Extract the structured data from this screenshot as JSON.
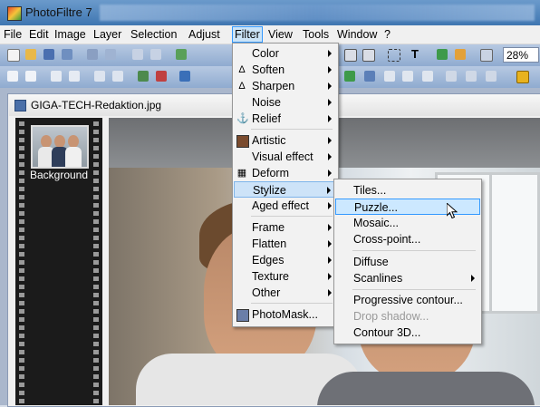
{
  "app": {
    "title": "PhotoFiltre 7"
  },
  "menubar": [
    "File",
    "Edit",
    "Image",
    "Layer",
    "Selection",
    "Adjust",
    "Filter",
    "View",
    "Tools",
    "Window",
    "?"
  ],
  "toolbar": {
    "zoom": "28%"
  },
  "document": {
    "title": "GIGA-TECH-Redaktion.jpg"
  },
  "layers": {
    "background_label": "Background"
  },
  "filter_menu": {
    "items": [
      {
        "label": "Color",
        "submenu": true
      },
      {
        "label": "Soften",
        "submenu": true,
        "icon": "drop-icon"
      },
      {
        "label": "Sharpen",
        "submenu": true,
        "icon": "drop-icon"
      },
      {
        "label": "Noise",
        "submenu": true
      },
      {
        "label": "Relief",
        "submenu": true,
        "icon": "relief-icon"
      },
      {
        "label": "Artistic",
        "submenu": true,
        "icon": "artistic-icon"
      },
      {
        "label": "Visual effect",
        "submenu": true
      },
      {
        "label": "Deform",
        "submenu": true,
        "icon": "grid-icon"
      },
      {
        "label": "Stylize",
        "submenu": true,
        "selected": true
      },
      {
        "label": "Aged effect",
        "submenu": true
      },
      {
        "label": "Frame",
        "submenu": true
      },
      {
        "label": "Flatten",
        "submenu": true
      },
      {
        "label": "Edges",
        "submenu": true
      },
      {
        "label": "Texture",
        "submenu": true
      },
      {
        "label": "Other",
        "submenu": true
      },
      {
        "label": "PhotoMask...",
        "submenu": false,
        "icon": "photomask-icon"
      }
    ]
  },
  "stylize_menu": {
    "items": [
      {
        "label": "Tiles..."
      },
      {
        "label": "Puzzle...",
        "hover": true
      },
      {
        "label": "Mosaic..."
      },
      {
        "label": "Cross-point..."
      },
      {
        "label": "Diffuse"
      },
      {
        "label": "Scanlines",
        "submenu": true
      },
      {
        "label": "Progressive contour..."
      },
      {
        "label": "Drop shadow...",
        "disabled": true
      },
      {
        "label": "Contour 3D..."
      }
    ]
  }
}
